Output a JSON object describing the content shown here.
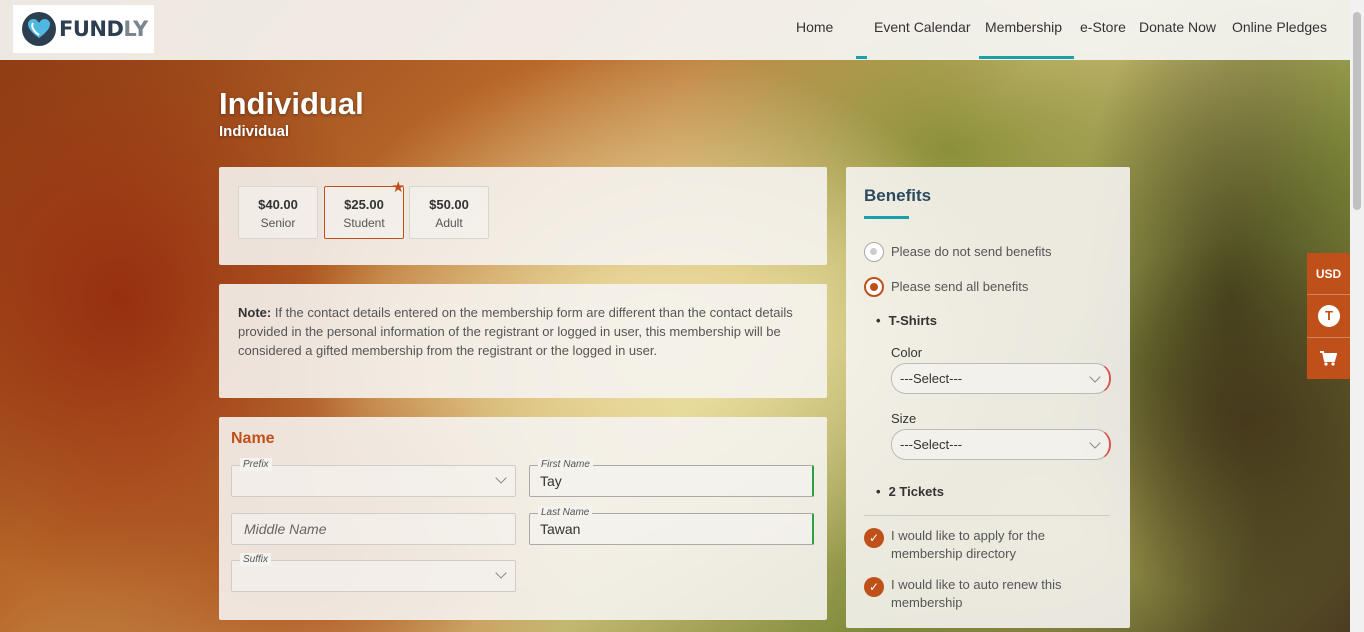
{
  "brand": {
    "logo_text_main": "FUND",
    "logo_text_accent": "LY"
  },
  "nav": {
    "items": [
      {
        "label": "Home"
      },
      {
        "label": "Event Calendar"
      },
      {
        "label": "Membership"
      },
      {
        "label": "e-Store"
      },
      {
        "label": "Donate Now"
      },
      {
        "label": "Online Pledges"
      }
    ],
    "active": "Membership"
  },
  "page": {
    "title": "Individual",
    "subtitle": "Individual"
  },
  "membership_options": [
    {
      "amount": "$40.00",
      "label": "Senior",
      "selected": false
    },
    {
      "amount": "$25.00",
      "label": "Student",
      "selected": true
    },
    {
      "amount": "$50.00",
      "label": "Adult",
      "selected": false
    }
  ],
  "note": {
    "label": "Note:",
    "text": " If the contact details entered on the membership form are different than the contact details provided in the personal information of the registrant or logged in user, this membership will be considered a gifted membership from the registrant or the logged in user."
  },
  "name_section": {
    "title": "Name",
    "prefix_label": "Prefix",
    "first_name_label": "First Name",
    "first_name_value": "Tay",
    "middle_name_placeholder": "Middle Name",
    "last_name_label": "Last Name",
    "last_name_value": "Tawan",
    "suffix_label": "Suffix"
  },
  "benefits": {
    "title": "Benefits",
    "option_none": "Please do not send benefits",
    "option_all": "Please send all benefits",
    "item1": "T-Shirts",
    "color_label": "Color",
    "color_value": "---Select---",
    "size_label": "Size",
    "size_value": "---Select---",
    "item2": "2 Tickets",
    "check_directory": "I would like to apply for the membership directory",
    "check_autorenew": "I would like to auto renew this membership"
  },
  "side_widget": {
    "currency": "USD",
    "t_label": "T"
  },
  "colors": {
    "accent": "#c0501a",
    "teal": "#1aa0a8",
    "navy": "#2c3e50",
    "valid": "#2e9e47"
  }
}
